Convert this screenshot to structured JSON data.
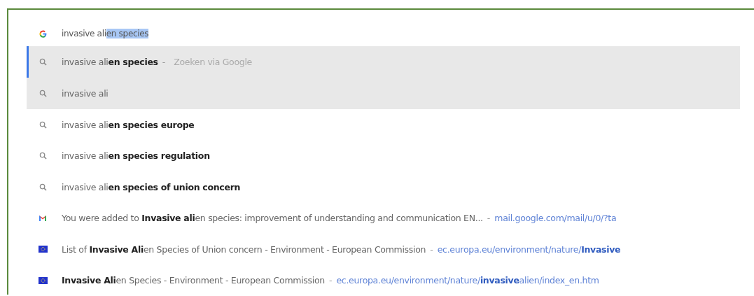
{
  "omnibox": {
    "kind": "google",
    "typed": "invasive ali",
    "selection": "en species"
  },
  "suggestions": [
    {
      "kind": "search",
      "text": "invasive ali**en species**",
      "separator": "-",
      "description": "Zoeken via Google",
      "selected": true,
      "highlighted": true
    },
    {
      "kind": "search",
      "text": "invasive ali",
      "selected": false,
      "highlighted": true
    },
    {
      "kind": "search",
      "text": "invasive ali**en species europe**",
      "selected": false,
      "highlighted": false
    },
    {
      "kind": "search",
      "text": "invasive ali**en species regulation**",
      "selected": false,
      "highlighted": false
    },
    {
      "kind": "search",
      "text": "invasive ali**en species of union concern**",
      "selected": false,
      "highlighted": false
    },
    {
      "kind": "mail",
      "text": "You were added to **Invasive ali**en species: improvement of understanding and communication EN...",
      "separator": "-",
      "url": "mail.google.com/mail/u/0/?ta",
      "selected": false,
      "highlighted": false
    },
    {
      "kind": "site",
      "text": "List of **Invasive Ali**en Species of Union concern - Environment - European Commission",
      "separator": "-",
      "url": "ec.europa.eu/environment/nature/**Invasive**",
      "selected": false,
      "highlighted": false
    },
    {
      "kind": "site",
      "text": "**Invasive Ali**en Species - Environment - European Commission",
      "separator": "-",
      "url": "ec.europa.eu/environment/nature/**invasive**alien/index_en.htm",
      "selected": false,
      "highlighted": false
    }
  ]
}
